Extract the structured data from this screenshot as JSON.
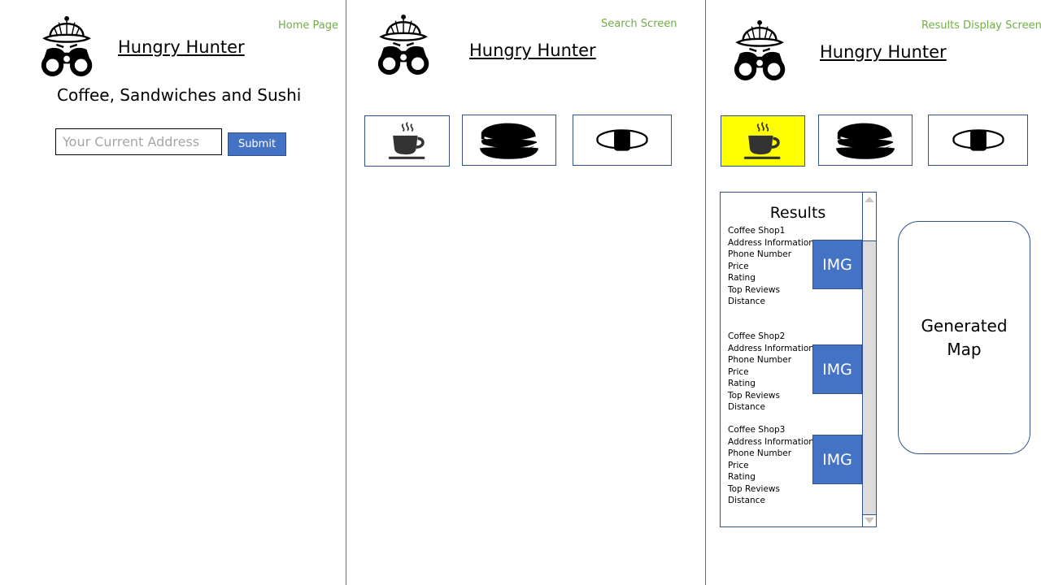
{
  "home": {
    "screen_label": "Home Page",
    "app_title": "Hungry Hunter",
    "tagline": "Coffee, Sandwiches and Sushi",
    "address_placeholder": "Your Current Address",
    "submit_label": "Submit"
  },
  "search": {
    "screen_label": "Search Screen",
    "app_title": "Hungry Hunter",
    "categories": [
      "coffee",
      "sandwich",
      "sushi"
    ]
  },
  "results_screen": {
    "screen_label": "Results Display Screen",
    "app_title": "Hungry Hunter",
    "selected_category": "coffee",
    "highlight_color": "#ffff00",
    "results_heading": "Results",
    "results": [
      {
        "name": "Coffee Shop1",
        "address": "Address Information",
        "phone": "Phone Number",
        "price": "Price",
        "rating": "Rating",
        "reviews": "Top Reviews",
        "distance": "Distance",
        "image_label": "IMG"
      },
      {
        "name": "Coffee Shop2",
        "address": "Address Information",
        "phone": "Phone Number",
        "price": "Price",
        "rating": "Rating",
        "reviews": "Top Reviews",
        "distance": "Distance",
        "image_label": "IMG"
      },
      {
        "name": "Coffee Shop3",
        "address": "Address Information",
        "phone": "Phone Number",
        "price": "Price",
        "rating": "Rating",
        "reviews": "Top Reviews",
        "distance": "Distance",
        "image_label": "IMG"
      }
    ],
    "map_label": "Generated Map"
  },
  "colors": {
    "accent": "#4472c4",
    "screen_label": "#70ad47",
    "border": "#2f528f"
  },
  "icons": [
    "explorer-logo-icon",
    "coffee-cup-icon",
    "sandwich-icon",
    "sushi-icon"
  ]
}
